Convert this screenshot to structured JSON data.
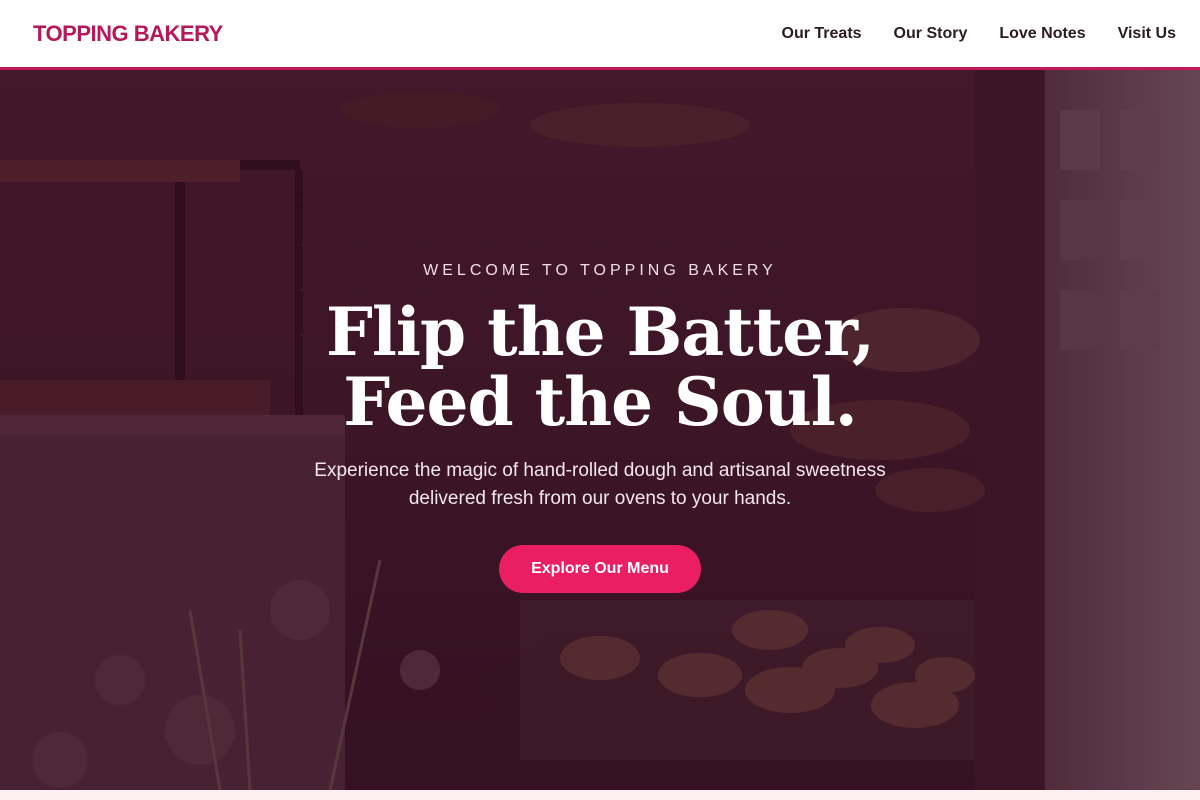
{
  "nav": {
    "brand": "TOPPING BAKERY",
    "links": [
      {
        "label": "Our Treats"
      },
      {
        "label": "Our Story"
      },
      {
        "label": "Love Notes"
      },
      {
        "label": "Visit Us"
      }
    ]
  },
  "hero": {
    "eyebrow": "WELCOME TO TOPPING BAKERY",
    "headline_line1": "Flip the Batter,",
    "headline_line2": "Feed the Soul.",
    "subtext_line1": "Experience the magic of hand-rolled dough and artisanal sweetness",
    "subtext_line2": "delivered fresh from our ovens to your hands.",
    "cta_label": "Explore Our Menu"
  },
  "colors": {
    "brand": "#b5195b",
    "accent": "#e91e63",
    "overlay": "#340e20"
  }
}
